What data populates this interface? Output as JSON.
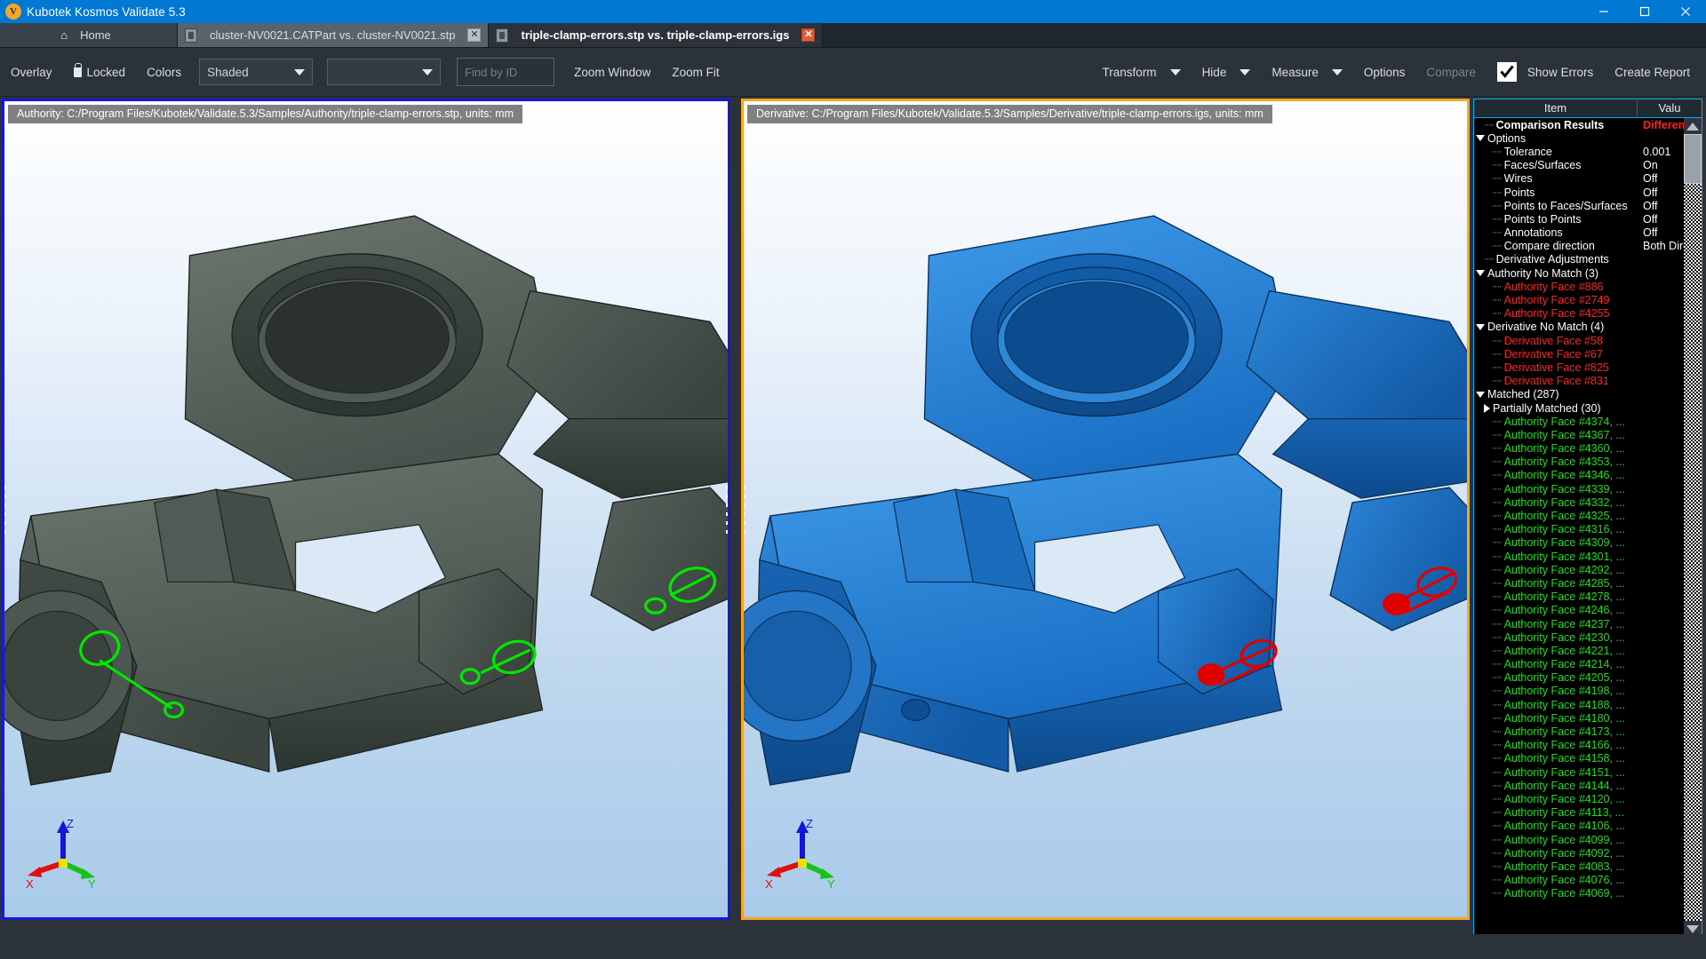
{
  "window": {
    "title": "Kubotek Kosmos Validate 5.3",
    "logo_glyph": "V",
    "minimize": "–",
    "maximize": "□",
    "close": "✕"
  },
  "tabs": [
    {
      "label": "Home",
      "type": "home",
      "icon": "home-icon"
    },
    {
      "label": "cluster-NV0021.CATPart vs. cluster-NV0021.stp",
      "type": "inactive",
      "close": "✕"
    },
    {
      "label": "triple-clamp-errors.stp vs. triple-clamp-errors.igs",
      "type": "active",
      "close": "✕"
    }
  ],
  "toolbar": {
    "overlay": "Overlay",
    "locked": "Locked",
    "colors": "Colors",
    "display_mode": "Shaded",
    "display_mode_2": "",
    "find_placeholder": "Find by ID",
    "find_value": "",
    "zoom_window": "Zoom Window",
    "zoom_fit": "Zoom Fit",
    "transform": "Transform",
    "hide": "Hide",
    "measure": "Measure",
    "options": "Options",
    "compare": "Compare",
    "show_errors": "Show Errors",
    "show_errors_checked": true,
    "create_report": "Create Report"
  },
  "viewports": [
    {
      "name": "authority",
      "label": "Authority:  C:/Program Files/Kubotek/Validate.5.3/Samples/Authority/triple-clamp-errors.stp, units: mm",
      "border_color": "#1717d6",
      "model_color": "#55605a",
      "marker_color": "#00e000"
    },
    {
      "name": "derivative",
      "label": "Derivative:  C:/Program Files/Kubotek/Validate.5.3/Samples/Derivative/triple-clamp-errors.igs, units: mm",
      "border_color": "#f5a623",
      "model_color": "#1878d4",
      "marker_color": "#e01010"
    }
  ],
  "triad": {
    "x": "X",
    "y": "Y",
    "z": "Z"
  },
  "tree": {
    "col_item": "Item",
    "col_value": "Valu",
    "rows": [
      {
        "label": "Comparison Results",
        "value": "Different",
        "indent": 1,
        "bold": true,
        "color": "white",
        "value_color": "red",
        "twisty": "none",
        "guide": true
      },
      {
        "label": "Options",
        "value": "",
        "indent": 0,
        "bold": false,
        "color": "white",
        "twisty": "down"
      },
      {
        "label": "Tolerance",
        "value": "0.001",
        "indent": 2,
        "color": "white",
        "twisty": "none",
        "guide": true
      },
      {
        "label": "Faces/Surfaces",
        "value": "On",
        "indent": 2,
        "color": "white",
        "twisty": "none",
        "guide": true
      },
      {
        "label": "Wires",
        "value": "Off",
        "indent": 2,
        "color": "white",
        "twisty": "none",
        "guide": true
      },
      {
        "label": "Points",
        "value": "Off",
        "indent": 2,
        "color": "white",
        "twisty": "none",
        "guide": true
      },
      {
        "label": "Points to Faces/Surfaces",
        "value": "Off",
        "indent": 2,
        "color": "white",
        "twisty": "none",
        "guide": true
      },
      {
        "label": "Points to Points",
        "value": "Off",
        "indent": 2,
        "color": "white",
        "twisty": "none",
        "guide": true
      },
      {
        "label": "Annotations",
        "value": "Off",
        "indent": 2,
        "color": "white",
        "twisty": "none",
        "guide": true
      },
      {
        "label": "Compare direction",
        "value": "Both Direc",
        "indent": 2,
        "color": "white",
        "twisty": "none",
        "guide": true
      },
      {
        "label": "Derivative Adjustments",
        "value": "",
        "indent": 1,
        "color": "white",
        "twisty": "none",
        "guide": true
      },
      {
        "label": "Authority No Match (3)",
        "value": "",
        "indent": 0,
        "color": "white",
        "twisty": "down"
      },
      {
        "label": "Authority Face #886",
        "value": "",
        "indent": 2,
        "color": "red",
        "twisty": "none",
        "guide": true
      },
      {
        "label": "Authority Face #2749",
        "value": "",
        "indent": 2,
        "color": "red",
        "twisty": "none",
        "guide": true
      },
      {
        "label": "Authority Face #4255",
        "value": "",
        "indent": 2,
        "color": "red",
        "twisty": "none",
        "guide": true
      },
      {
        "label": "Derivative No Match (4)",
        "value": "",
        "indent": 0,
        "color": "white",
        "twisty": "down"
      },
      {
        "label": "Derivative Face #58",
        "value": "",
        "indent": 2,
        "color": "red",
        "twisty": "none",
        "guide": true
      },
      {
        "label": "Derivative Face #67",
        "value": "",
        "indent": 2,
        "color": "red",
        "twisty": "none",
        "guide": true
      },
      {
        "label": "Derivative Face #825",
        "value": "",
        "indent": 2,
        "color": "red",
        "twisty": "none",
        "guide": true
      },
      {
        "label": "Derivative Face #831",
        "value": "",
        "indent": 2,
        "color": "red",
        "twisty": "none",
        "guide": true
      },
      {
        "label": "Matched (287)",
        "value": "",
        "indent": 0,
        "color": "white",
        "twisty": "down"
      },
      {
        "label": "Partially Matched (30)",
        "value": "",
        "indent": 1,
        "color": "white",
        "twisty": "right"
      },
      {
        "label": "Authority Face #4374, ...",
        "value": "",
        "indent": 2,
        "color": "green",
        "twisty": "none",
        "guide": true
      },
      {
        "label": "Authority Face #4367, ...",
        "value": "",
        "indent": 2,
        "color": "green",
        "twisty": "none",
        "guide": true
      },
      {
        "label": "Authority Face #4360, ...",
        "value": "",
        "indent": 2,
        "color": "green",
        "twisty": "none",
        "guide": true
      },
      {
        "label": "Authority Face #4353, ...",
        "value": "",
        "indent": 2,
        "color": "green",
        "twisty": "none",
        "guide": true
      },
      {
        "label": "Authority Face #4346, ...",
        "value": "",
        "indent": 2,
        "color": "green",
        "twisty": "none",
        "guide": true
      },
      {
        "label": "Authority Face #4339, ...",
        "value": "",
        "indent": 2,
        "color": "green",
        "twisty": "none",
        "guide": true
      },
      {
        "label": "Authority Face #4332, ...",
        "value": "",
        "indent": 2,
        "color": "green",
        "twisty": "none",
        "guide": true
      },
      {
        "label": "Authority Face #4325, ...",
        "value": "",
        "indent": 2,
        "color": "green",
        "twisty": "none",
        "guide": true
      },
      {
        "label": "Authority Face #4316, ...",
        "value": "",
        "indent": 2,
        "color": "green",
        "twisty": "none",
        "guide": true
      },
      {
        "label": "Authority Face #4309, ...",
        "value": "",
        "indent": 2,
        "color": "green",
        "twisty": "none",
        "guide": true
      },
      {
        "label": "Authority Face #4301, ...",
        "value": "",
        "indent": 2,
        "color": "green",
        "twisty": "none",
        "guide": true
      },
      {
        "label": "Authority Face #4292, ...",
        "value": "",
        "indent": 2,
        "color": "green",
        "twisty": "none",
        "guide": true
      },
      {
        "label": "Authority Face #4285, ...",
        "value": "",
        "indent": 2,
        "color": "green",
        "twisty": "none",
        "guide": true
      },
      {
        "label": "Authority Face #4278, ...",
        "value": "",
        "indent": 2,
        "color": "green",
        "twisty": "none",
        "guide": true
      },
      {
        "label": "Authority Face #4246, ...",
        "value": "",
        "indent": 2,
        "color": "green",
        "twisty": "none",
        "guide": true
      },
      {
        "label": "Authority Face #4237, ...",
        "value": "",
        "indent": 2,
        "color": "green",
        "twisty": "none",
        "guide": true
      },
      {
        "label": "Authority Face #4230, ...",
        "value": "",
        "indent": 2,
        "color": "green",
        "twisty": "none",
        "guide": true
      },
      {
        "label": "Authority Face #4221, ...",
        "value": "",
        "indent": 2,
        "color": "green",
        "twisty": "none",
        "guide": true
      },
      {
        "label": "Authority Face #4214, ...",
        "value": "",
        "indent": 2,
        "color": "green",
        "twisty": "none",
        "guide": true
      },
      {
        "label": "Authority Face #4205, ...",
        "value": "",
        "indent": 2,
        "color": "green",
        "twisty": "none",
        "guide": true
      },
      {
        "label": "Authority Face #4198, ...",
        "value": "",
        "indent": 2,
        "color": "green",
        "twisty": "none",
        "guide": true
      },
      {
        "label": "Authority Face #4188, ...",
        "value": "",
        "indent": 2,
        "color": "green",
        "twisty": "none",
        "guide": true
      },
      {
        "label": "Authority Face #4180, ...",
        "value": "",
        "indent": 2,
        "color": "green",
        "twisty": "none",
        "guide": true
      },
      {
        "label": "Authority Face #4173, ...",
        "value": "",
        "indent": 2,
        "color": "green",
        "twisty": "none",
        "guide": true
      },
      {
        "label": "Authority Face #4166, ...",
        "value": "",
        "indent": 2,
        "color": "green",
        "twisty": "none",
        "guide": true
      },
      {
        "label": "Authority Face #4158, ...",
        "value": "",
        "indent": 2,
        "color": "green",
        "twisty": "none",
        "guide": true
      },
      {
        "label": "Authority Face #4151, ...",
        "value": "",
        "indent": 2,
        "color": "green",
        "twisty": "none",
        "guide": true
      },
      {
        "label": "Authority Face #4144, ...",
        "value": "",
        "indent": 2,
        "color": "green",
        "twisty": "none",
        "guide": true
      },
      {
        "label": "Authority Face #4120, ...",
        "value": "",
        "indent": 2,
        "color": "green",
        "twisty": "none",
        "guide": true
      },
      {
        "label": "Authority Face #4113, ...",
        "value": "",
        "indent": 2,
        "color": "green",
        "twisty": "none",
        "guide": true
      },
      {
        "label": "Authority Face #4106, ...",
        "value": "",
        "indent": 2,
        "color": "green",
        "twisty": "none",
        "guide": true
      },
      {
        "label": "Authority Face #4099, ...",
        "value": "",
        "indent": 2,
        "color": "green",
        "twisty": "none",
        "guide": true
      },
      {
        "label": "Authority Face #4092, ...",
        "value": "",
        "indent": 2,
        "color": "green",
        "twisty": "none",
        "guide": true
      },
      {
        "label": "Authority Face #4083, ...",
        "value": "",
        "indent": 2,
        "color": "green",
        "twisty": "none",
        "guide": true
      },
      {
        "label": "Authority Face #4076, ...",
        "value": "",
        "indent": 2,
        "color": "green",
        "twisty": "none",
        "guide": true
      },
      {
        "label": "Authority Face #4069, ...",
        "value": "",
        "indent": 2,
        "color": "green",
        "twisty": "none",
        "guide": true
      }
    ]
  }
}
